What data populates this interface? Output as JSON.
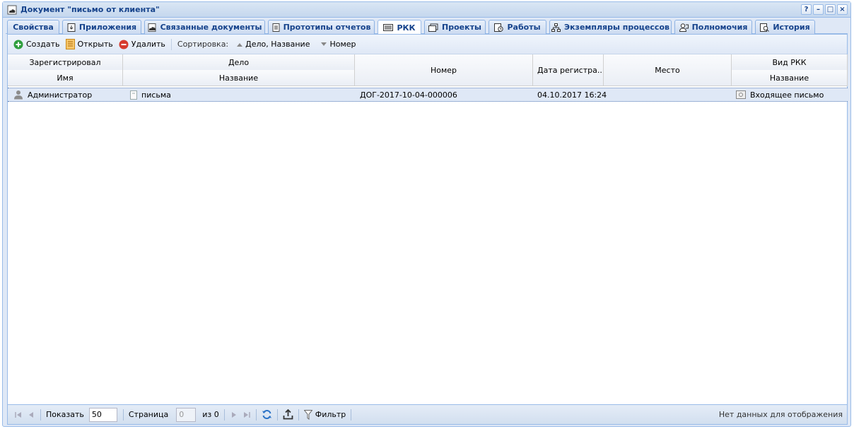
{
  "window": {
    "title": "Документ \"письмо от клиента\""
  },
  "title_buttons": [
    "?",
    "–",
    "□",
    "×"
  ],
  "tabs": [
    {
      "label": "Свойства",
      "icon": "none"
    },
    {
      "label": "Приложения",
      "icon": "attachment-icon"
    },
    {
      "label": "Связанные документы",
      "icon": "linked-docs-icon"
    },
    {
      "label": "Прототипы отчетов",
      "icon": "report-icon"
    },
    {
      "label": "РКК",
      "icon": "registration-card-icon",
      "active": true
    },
    {
      "label": "Проекты",
      "icon": "projects-icon"
    },
    {
      "label": "Работы",
      "icon": "tasks-icon"
    },
    {
      "label": "Экземпляры процессов",
      "icon": "process-icon"
    },
    {
      "label": "Полномочия",
      "icon": "permissions-icon"
    },
    {
      "label": "История",
      "icon": "history-icon"
    }
  ],
  "toolbar": {
    "create": "Создать",
    "open": "Открыть",
    "delete": "Удалить",
    "sort_label": "Сортировка:",
    "sort_1": "Дело, Название",
    "sort_2": "Номер"
  },
  "grid": {
    "group_headers": {
      "registered_by": "Зарегистрировал",
      "case": "Дело",
      "number": "Номер",
      "reg_date": "Дата регистра...",
      "place": "Место",
      "card_type": "Вид РКК"
    },
    "sub_headers": {
      "name": "Имя",
      "case_title": "Название",
      "card_title": "Название"
    },
    "rows": [
      {
        "user": "Администратор",
        "case": "письма",
        "number": "ДОГ-2017-10-04-000006",
        "date": "04.10.2017 16:24",
        "place": "",
        "card_type": "Входящее письмо"
      }
    ]
  },
  "footer": {
    "show_label": "Показать",
    "page_size": "50",
    "page_label": "Страница",
    "page_value": "0",
    "of_label": "из 0",
    "filter_label": "Фильтр",
    "status": "Нет данных для отображения"
  },
  "colors": {
    "accent": "#15428b",
    "border": "#99bbe8",
    "selection": "#dfe8f6"
  }
}
